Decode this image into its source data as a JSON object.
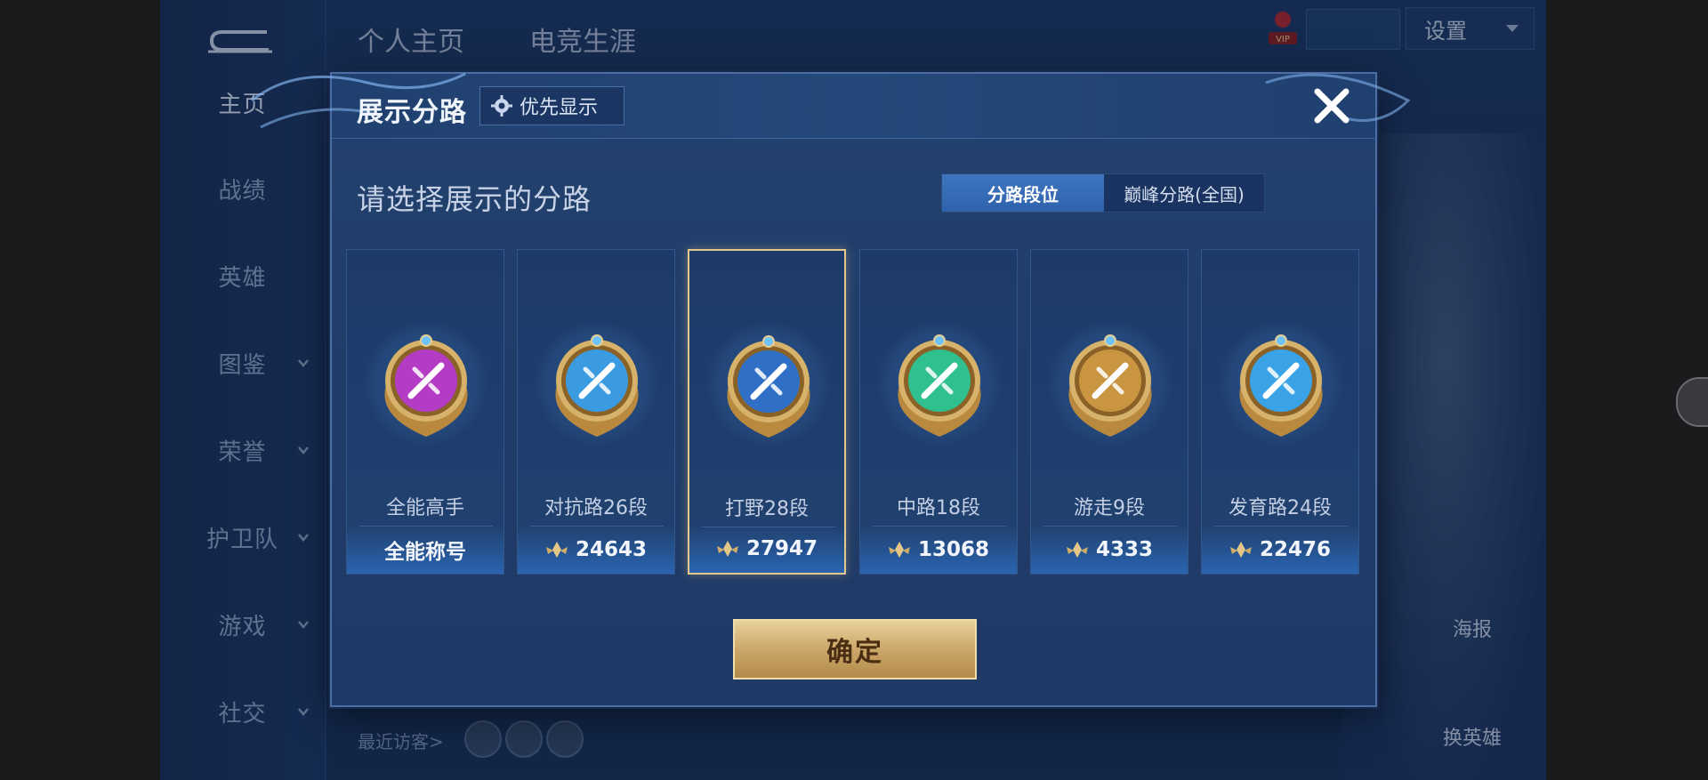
{
  "sidebar": {
    "items": [
      {
        "label": "主页",
        "active": true,
        "chevron": false
      },
      {
        "label": "战绩",
        "active": false,
        "chevron": false
      },
      {
        "label": "英雄",
        "active": false,
        "chevron": false
      },
      {
        "label": "图鉴",
        "active": false,
        "chevron": true
      },
      {
        "label": "荣誉",
        "active": false,
        "chevron": true
      },
      {
        "label": "护卫队",
        "active": false,
        "chevron": true
      },
      {
        "label": "游戏",
        "active": false,
        "chevron": true
      },
      {
        "label": "社交",
        "active": false,
        "chevron": true
      }
    ]
  },
  "header": {
    "tabs": [
      "个人主页",
      "电竞生涯"
    ],
    "settings_label": "设置"
  },
  "background": {
    "poster_label": "海报",
    "switch_hero_label": "换英雄",
    "recent_visitors_label": "最近访客>"
  },
  "modal": {
    "title": "展示分路",
    "priority_label": "优先显示",
    "subtitle": "请选择展示的分路",
    "segments": [
      "分路段位",
      "巅峰分路(全国)"
    ],
    "active_segment": 0,
    "confirm_label": "确定",
    "cards": [
      {
        "name": "全能高手",
        "footer": "全能称号",
        "has_points": false,
        "selected": false,
        "emblem": "all-round-emblem",
        "color": "#b43bc4"
      },
      {
        "name": "对抗路26段",
        "footer": "24643",
        "has_points": true,
        "selected": false,
        "emblem": "clash-lane-emblem",
        "color": "#3a9be0"
      },
      {
        "name": "打野28段",
        "footer": "27947",
        "has_points": true,
        "selected": true,
        "emblem": "jungle-emblem",
        "color": "#2f6fc6"
      },
      {
        "name": "中路18段",
        "footer": "13068",
        "has_points": true,
        "selected": false,
        "emblem": "mid-lane-emblem",
        "color": "#2fc08f"
      },
      {
        "name": "游走9段",
        "footer": "4333",
        "has_points": true,
        "selected": false,
        "emblem": "roam-emblem",
        "color": "#c99540"
      },
      {
        "name": "发育路24段",
        "footer": "22476",
        "has_points": true,
        "selected": false,
        "emblem": "farm-lane-emblem",
        "color": "#3aa3e8"
      }
    ]
  },
  "colors": {
    "accent_gold": "#e5c88c",
    "segment_active": "#3f76c0",
    "modal_bg": "#203c68"
  }
}
